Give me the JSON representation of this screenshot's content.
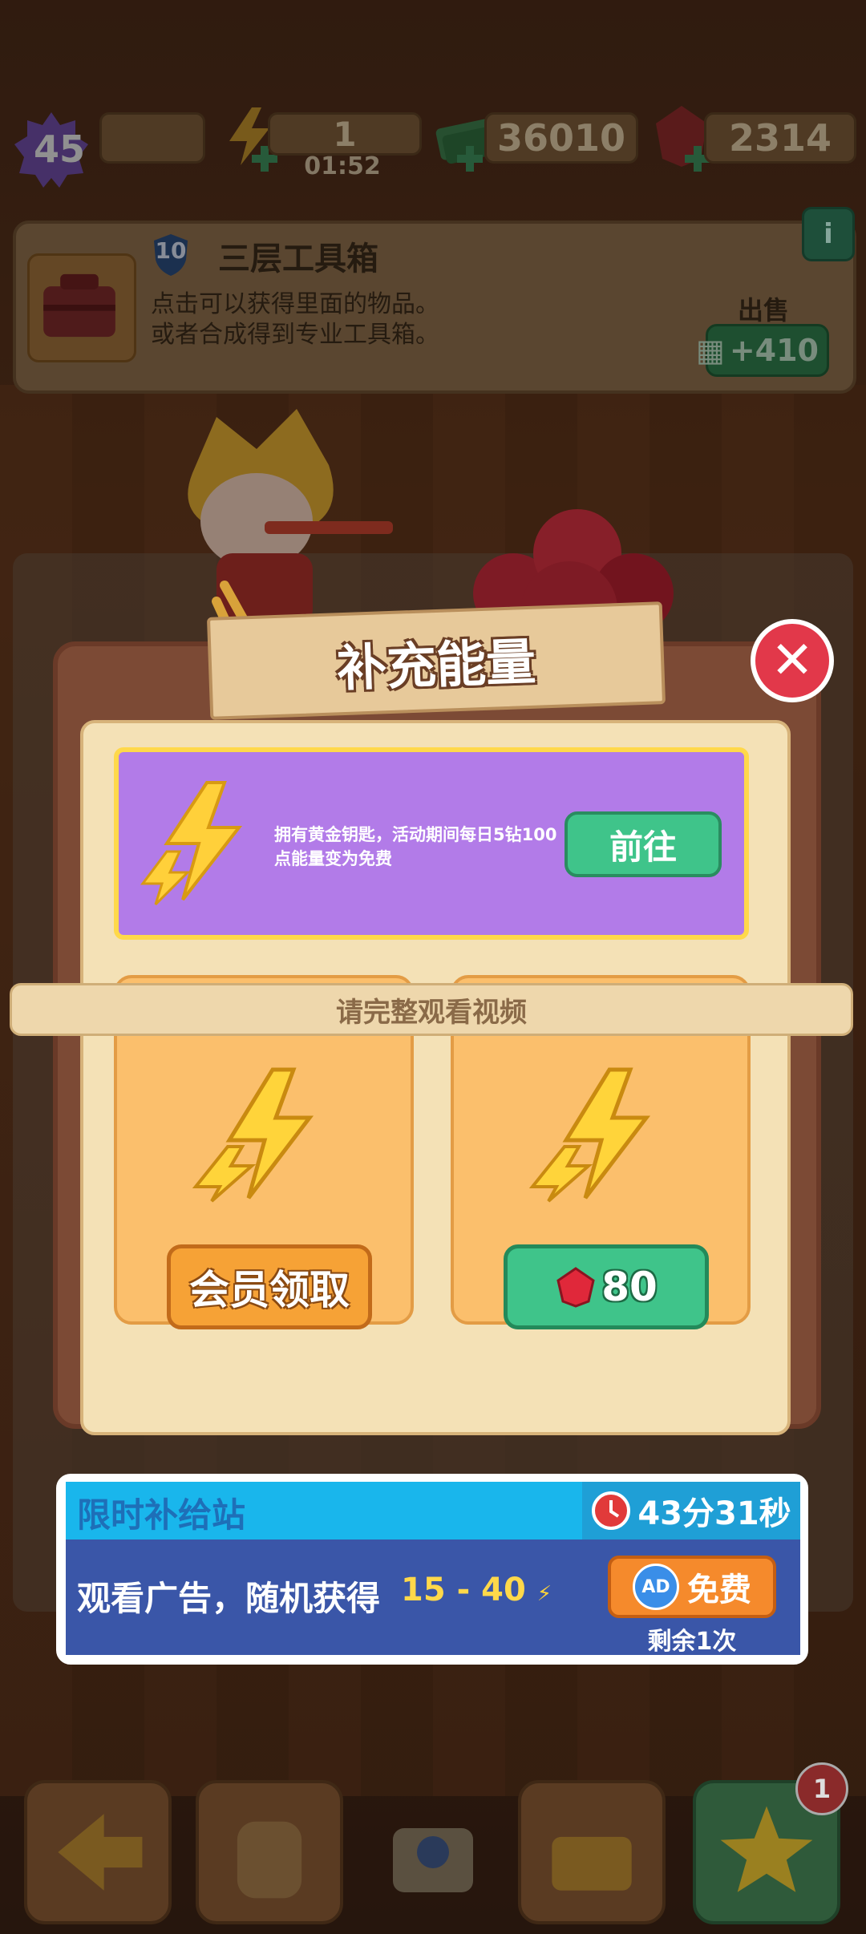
{
  "top_bar": {
    "level": "45",
    "energy": "1",
    "energy_timer": "01:52",
    "cash": "36010",
    "gems": "2314"
  },
  "item_info": {
    "level_badge": "10",
    "name": "三层工具箱",
    "desc_line1": "点击可以获得里面的物品。",
    "desc_line2": "或者合成得到专业工具箱。",
    "sell_label": "出售",
    "sell_value": "+410",
    "info_icon": "i"
  },
  "dialog": {
    "title": "补充能量",
    "close_icon": "close-icon",
    "promo": {
      "text": "拥有黄金钥匙，活动期间每日5钻100点能量变为免费",
      "button_label": "前往"
    },
    "video_hint": "请完整观看视频",
    "cards": {
      "vip_label": "会员领取",
      "gem_cost": "80"
    }
  },
  "supply_station": {
    "title": "限时补给站",
    "timer": "43分31秒",
    "description": "观看广告，随机获得",
    "range": "15 - 40",
    "free_badge": "AD",
    "free_label": "免费",
    "remaining": "剩余1次"
  },
  "bottom_nav": {
    "badge_count": "1",
    "icons": [
      "back-arrow-icon",
      "backpack-icon",
      "toolbox-icon",
      "basket-icon",
      "star-icon"
    ]
  },
  "colors": {
    "dialog_frame": "#7c4a35",
    "promo_bg": "#b27be8",
    "green_button": "#3fc48a",
    "orange_button": "#f6a236",
    "supply_header": "#19b6ec",
    "close_red": "#e2384a"
  }
}
